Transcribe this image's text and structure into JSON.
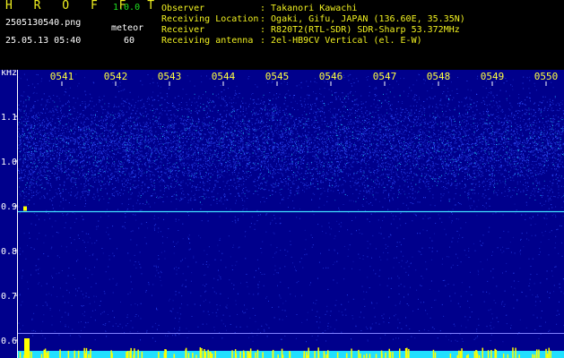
{
  "header": {
    "app_title": "H R O F F T",
    "app_version": "1.0.0",
    "filename": "2505130540.png",
    "mode": "meteor",
    "datetime": "25.05.13 05:40",
    "count": "60",
    "info": [
      {
        "key": "Observer",
        "value": ": Takanori Kawachi"
      },
      {
        "key": "Receiving Location",
        "value": ": Ogaki, Gifu, JAPAN (136.60E, 35.35N)"
      },
      {
        "key": "Receiver",
        "value": ": R820T2(RTL-SDR) SDR-Sharp 53.372MHz"
      },
      {
        "key": "Receiving antenna",
        "value": ": 2el-HB9CV Vertical (el. E-W)"
      }
    ]
  },
  "chart_data": {
    "type": "heatmap",
    "ylabel": "kHz",
    "x_ticks": [
      "0541",
      "0542",
      "0543",
      "0544",
      "0545",
      "0546",
      "0547",
      "0548",
      "0549",
      "0550"
    ],
    "y_ticks": [
      "1.1",
      "1.0",
      "0.9",
      "0.8",
      "0.7",
      "0.6"
    ],
    "ylim": [
      0.58,
      1.2
    ],
    "carrier_khz": 0.887,
    "noise_band_khz": [
      0.9,
      1.16
    ],
    "colors": {
      "background": "#00008c",
      "noise": "#3050ff",
      "bright": "#20d0ff",
      "carrier": "#40e0ff",
      "meteor": "#ffff00"
    }
  }
}
